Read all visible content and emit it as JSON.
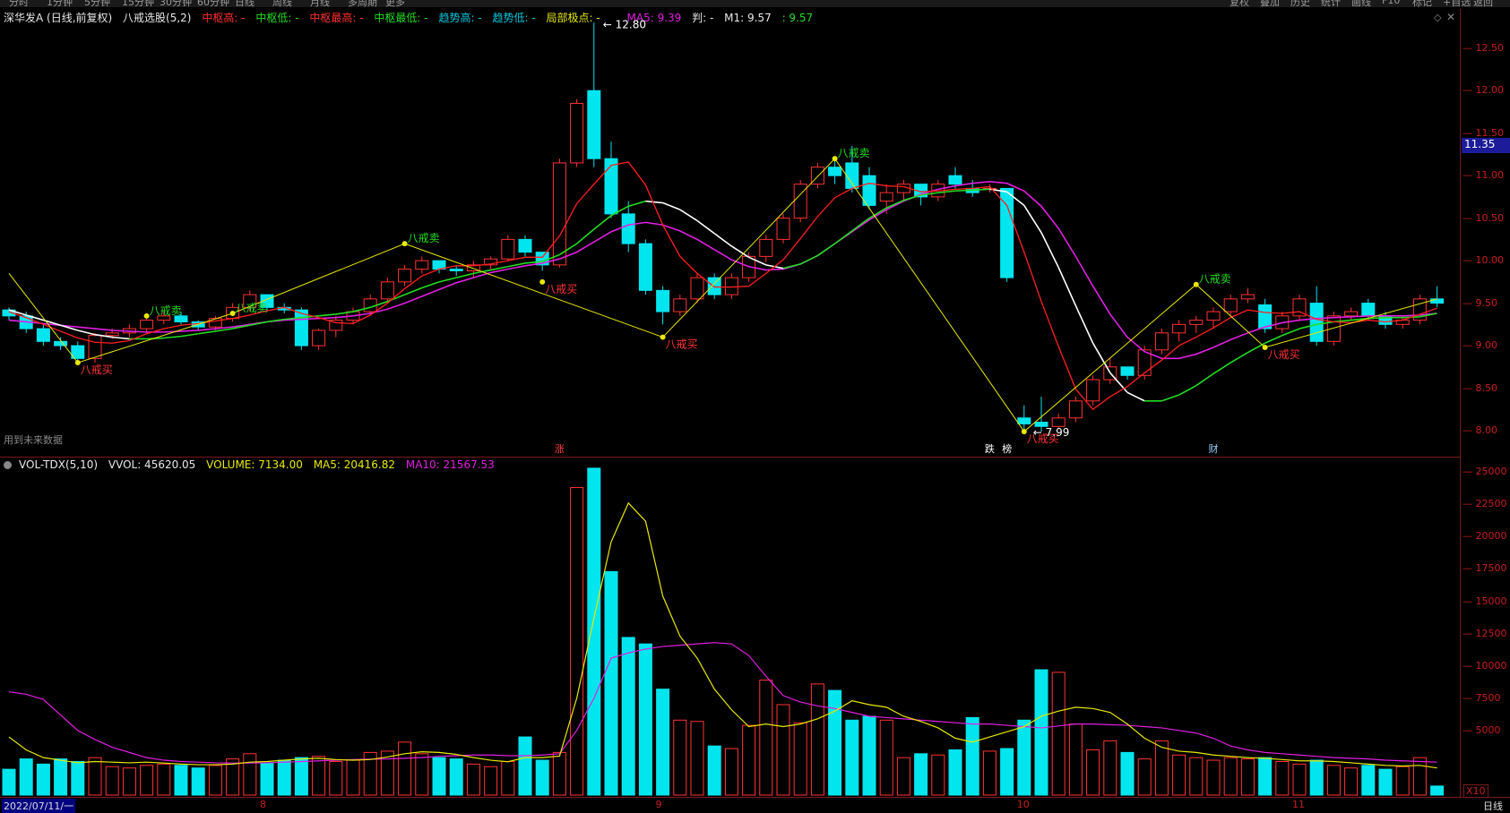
{
  "toolbar_left": [
    "分时",
    "1分钟",
    "5分钟",
    "15分钟",
    "30分钟",
    "60分钟",
    "日线",
    "周线",
    "月线",
    "多周期",
    "更多"
  ],
  "toolbar_right": [
    "复权",
    "叠加",
    "历史",
    "统计",
    "画线",
    "F10",
    "标记",
    "+自选",
    "返回"
  ],
  "header": {
    "stock": "深华发A (日线,前复权)",
    "indicator": "八戒选股(5,2)",
    "zg_high": "中枢高: -",
    "zg_low": "中枢低: -",
    "zg_max": "中枢最高: -",
    "zg_min": "中枢最低: -",
    "trend_high": "趋势高: -",
    "trend_low": "趋势低: -",
    "local_pt": "局部极点: -",
    "ma5": "MA5: 9.39",
    "judge": "判: -",
    "m1": "M1: 9.57",
    "m1b": ": 9.57"
  },
  "vol_header": {
    "name": "VOL-TDX(5,10)",
    "vvol": "VVOL: 45620.05",
    "volume": "VOLUME: 7134.00",
    "ma5": "MA5: 20416.82",
    "ma10": "MA10: 21567.53"
  },
  "future_note": "用到未来数据",
  "current_price_tag": "11.35",
  "x10_label": "X10",
  "period_label": "日线",
  "start_date": "2022/07/11/一",
  "months": [
    {
      "label": "8",
      "i": 15
    },
    {
      "label": "9",
      "i": 38
    },
    {
      "label": "10",
      "i": 59
    },
    {
      "label": "11",
      "i": 75
    }
  ],
  "events": [
    {
      "label": "涨",
      "i": 32
    },
    {
      "label": "跌",
      "i": 57
    },
    {
      "label": "榜",
      "i": 58
    },
    {
      "label": "财",
      "i": 70
    }
  ],
  "signal_labels": {
    "sell": "八戒卖",
    "buy": "八戒买"
  },
  "peak_high_label": "12.80",
  "trough_low_label": "7.99",
  "colors": {
    "up": "#ff3333",
    "down": "#00e5ee",
    "ma5": "#ff2020",
    "m1_white": "#ffffff",
    "m1_green": "#22dd22",
    "magenta": "#e020e0",
    "yellow": "#e8e800",
    "axis": "#c82020"
  },
  "chart_data": [
    {
      "type": "candlestick",
      "ylim": [
        7.8,
        12.75
      ],
      "yticks": [
        8.0,
        8.5,
        9.0,
        9.5,
        10.0,
        10.5,
        11.0,
        11.5,
        12.0,
        12.5
      ],
      "ohlc": [
        [
          9.42,
          9.45,
          9.3,
          9.35
        ],
        [
          9.35,
          9.4,
          9.15,
          9.2
        ],
        [
          9.2,
          9.25,
          9.0,
          9.05
        ],
        [
          9.05,
          9.1,
          8.95,
          9.0
        ],
        [
          9.0,
          9.05,
          8.8,
          8.85
        ],
        [
          8.85,
          9.15,
          8.8,
          9.12
        ],
        [
          9.12,
          9.2,
          9.08,
          9.15
        ],
        [
          9.15,
          9.25,
          9.1,
          9.2
        ],
        [
          9.2,
          9.35,
          9.15,
          9.3
        ],
        [
          9.3,
          9.4,
          9.25,
          9.35
        ],
        [
          9.35,
          9.4,
          9.25,
          9.28
        ],
        [
          9.28,
          9.3,
          9.18,
          9.22
        ],
        [
          9.22,
          9.35,
          9.18,
          9.32
        ],
        [
          9.32,
          9.5,
          9.28,
          9.45
        ],
        [
          9.45,
          9.65,
          9.4,
          9.6
        ],
        [
          9.6,
          9.55,
          9.4,
          9.45
        ],
        [
          9.45,
          9.5,
          9.38,
          9.42
        ],
        [
          9.42,
          9.45,
          8.95,
          9.0
        ],
        [
          9.0,
          9.2,
          8.95,
          9.18
        ],
        [
          9.18,
          9.35,
          9.1,
          9.3
        ],
        [
          9.3,
          9.45,
          9.25,
          9.4
        ],
        [
          9.4,
          9.6,
          9.35,
          9.55
        ],
        [
          9.55,
          9.8,
          9.5,
          9.75
        ],
        [
          9.75,
          9.95,
          9.7,
          9.9
        ],
        [
          9.9,
          10.05,
          9.85,
          10.0
        ],
        [
          10.0,
          9.98,
          9.85,
          9.9
        ],
        [
          9.9,
          9.95,
          9.82,
          9.88
        ],
        [
          9.88,
          10.0,
          9.8,
          9.95
        ],
        [
          9.95,
          10.05,
          9.9,
          10.02
        ],
        [
          10.02,
          10.3,
          10.0,
          10.25
        ],
        [
          10.25,
          10.3,
          10.05,
          10.1
        ],
        [
          10.1,
          10.05,
          9.88,
          9.95
        ],
        [
          9.95,
          11.2,
          9.92,
          11.15
        ],
        [
          11.15,
          11.9,
          11.1,
          11.85
        ],
        [
          12.0,
          12.8,
          11.1,
          11.2
        ],
        [
          11.2,
          11.4,
          10.5,
          10.55
        ],
        [
          10.55,
          10.7,
          10.1,
          10.2
        ],
        [
          10.2,
          10.25,
          9.6,
          9.65
        ],
        [
          9.65,
          9.7,
          9.25,
          9.4
        ],
        [
          9.4,
          9.6,
          9.35,
          9.55
        ],
        [
          9.55,
          9.85,
          9.5,
          9.8
        ],
        [
          9.8,
          9.85,
          9.55,
          9.6
        ],
        [
          9.6,
          9.85,
          9.55,
          9.8
        ],
        [
          9.8,
          10.1,
          9.75,
          10.05
        ],
        [
          10.05,
          10.3,
          9.98,
          10.25
        ],
        [
          10.25,
          10.55,
          10.2,
          10.5
        ],
        [
          10.5,
          10.95,
          10.45,
          10.9
        ],
        [
          10.9,
          11.15,
          10.85,
          11.1
        ],
        [
          11.1,
          11.2,
          10.9,
          11.0
        ],
        [
          11.15,
          11.35,
          10.8,
          10.85
        ],
        [
          11.0,
          11.1,
          10.6,
          10.65
        ],
        [
          10.7,
          10.9,
          10.55,
          10.8
        ],
        [
          10.8,
          10.95,
          10.7,
          10.9
        ],
        [
          10.9,
          10.85,
          10.65,
          10.75
        ],
        [
          10.75,
          10.95,
          10.7,
          10.9
        ],
        [
          11.0,
          11.1,
          10.85,
          10.9
        ],
        [
          10.85,
          10.95,
          10.75,
          10.8
        ],
        [
          10.85,
          10.9,
          10.8,
          10.85
        ],
        [
          10.85,
          10.7,
          9.75,
          9.8
        ],
        [
          8.15,
          8.3,
          7.99,
          8.08
        ],
        [
          8.1,
          8.4,
          7.99,
          8.05
        ],
        [
          8.05,
          8.2,
          8.02,
          8.15
        ],
        [
          8.15,
          8.4,
          8.1,
          8.35
        ],
        [
          8.35,
          8.65,
          8.3,
          8.6
        ],
        [
          8.6,
          8.85,
          8.55,
          8.75
        ],
        [
          8.75,
          8.72,
          8.6,
          8.65
        ],
        [
          8.65,
          9.0,
          8.6,
          8.95
        ],
        [
          8.95,
          9.2,
          8.9,
          9.15
        ],
        [
          9.15,
          9.3,
          9.05,
          9.25
        ],
        [
          9.25,
          9.35,
          9.15,
          9.3
        ],
        [
          9.3,
          9.45,
          9.2,
          9.4
        ],
        [
          9.4,
          9.6,
          9.35,
          9.55
        ],
        [
          9.55,
          9.68,
          9.5,
          9.6
        ],
        [
          9.48,
          9.55,
          9.15,
          9.2
        ],
        [
          9.2,
          9.4,
          9.15,
          9.35
        ],
        [
          9.35,
          9.6,
          9.3,
          9.55
        ],
        [
          9.5,
          9.7,
          9.0,
          9.05
        ],
        [
          9.05,
          9.4,
          9.0,
          9.35
        ],
        [
          9.35,
          9.45,
          9.3,
          9.4
        ],
        [
          9.5,
          9.55,
          9.3,
          9.35
        ],
        [
          9.35,
          9.4,
          9.2,
          9.25
        ],
        [
          9.25,
          9.35,
          9.2,
          9.3
        ],
        [
          9.3,
          9.6,
          9.25,
          9.55
        ],
        [
          9.55,
          9.7,
          9.45,
          9.5
        ]
      ],
      "ma5": [
        9.4,
        9.33,
        9.25,
        9.17,
        9.09,
        9.04,
        9.03,
        9.06,
        9.14,
        9.2,
        9.24,
        9.26,
        9.29,
        9.32,
        9.36,
        9.41,
        9.45,
        9.38,
        9.33,
        9.27,
        9.26,
        9.36,
        9.5,
        9.67,
        9.82,
        9.9,
        9.94,
        9.94,
        9.96,
        10.0,
        10.04,
        10.04,
        10.29,
        10.67,
        10.9,
        11.12,
        11.16,
        10.89,
        10.42,
        10.05,
        9.85,
        9.69,
        9.69,
        9.7,
        9.85,
        10.01,
        10.26,
        10.52,
        10.74,
        10.85,
        10.91,
        10.88,
        10.87,
        10.81,
        10.82,
        10.84,
        10.85,
        10.87,
        10.65,
        10.1,
        9.52,
        8.99,
        8.49,
        8.25,
        8.4,
        8.52,
        8.68,
        8.83,
        9.0,
        9.1,
        9.21,
        9.33,
        9.42,
        9.39,
        9.38,
        9.4,
        9.31,
        9.28,
        9.27,
        9.3,
        9.28,
        9.3,
        9.37,
        9.44
      ],
      "m1": [
        9.42,
        9.36,
        9.3,
        9.24,
        9.18,
        9.13,
        9.1,
        9.08,
        9.08,
        9.09,
        9.11,
        9.14,
        9.17,
        9.2,
        9.24,
        9.28,
        9.31,
        9.33,
        9.35,
        9.37,
        9.4,
        9.45,
        9.52,
        9.6,
        9.68,
        9.75,
        9.8,
        9.85,
        9.89,
        9.93,
        9.97,
        9.99,
        10.07,
        10.2,
        10.37,
        10.53,
        10.64,
        10.7,
        10.68,
        10.6,
        10.47,
        10.32,
        10.17,
        10.04,
        9.95,
        9.91,
        9.96,
        10.06,
        10.2,
        10.35,
        10.5,
        10.62,
        10.71,
        10.77,
        10.8,
        10.82,
        10.83,
        10.84,
        10.81,
        10.65,
        10.33,
        9.92,
        9.47,
        9.03,
        8.68,
        8.45,
        8.35,
        8.35,
        8.42,
        8.53,
        8.67,
        8.8,
        8.92,
        9.03,
        9.12,
        9.2,
        9.25,
        9.28,
        9.3,
        9.32,
        9.33,
        9.33,
        9.34,
        9.38
      ],
      "ma_long": [
        9.3,
        9.28,
        9.26,
        9.24,
        9.22,
        9.2,
        9.18,
        9.17,
        9.16,
        9.16,
        9.17,
        9.18,
        9.2,
        9.22,
        9.25,
        9.28,
        9.3,
        9.31,
        9.32,
        9.33,
        9.35,
        9.38,
        9.43,
        9.5,
        9.58,
        9.66,
        9.74,
        9.8,
        9.86,
        9.9,
        9.94,
        9.97,
        10.02,
        10.1,
        10.22,
        10.34,
        10.42,
        10.45,
        10.42,
        10.35,
        10.25,
        10.13,
        10.01,
        9.93,
        9.89,
        9.9,
        9.96,
        10.06,
        10.2,
        10.34,
        10.48,
        10.6,
        10.7,
        10.78,
        10.84,
        10.88,
        10.91,
        10.93,
        10.91,
        10.82,
        10.64,
        10.38,
        10.05,
        9.7,
        9.37,
        9.1,
        8.93,
        8.85,
        8.85,
        8.9,
        8.98,
        9.07,
        9.15,
        9.22,
        9.27,
        9.3,
        9.32,
        9.33,
        9.34,
        9.35,
        9.35,
        9.35,
        9.36,
        9.38
      ],
      "zigzag": [
        [
          0,
          9.85
        ],
        [
          4,
          8.8
        ],
        [
          13,
          9.38
        ],
        [
          23,
          10.2
        ],
        [
          38,
          9.1
        ],
        [
          48,
          11.2
        ],
        [
          59,
          7.99
        ],
        [
          69,
          9.72
        ],
        [
          73,
          8.98
        ],
        [
          83,
          9.55
        ]
      ],
      "sell_signals": [
        [
          13,
          9.38
        ],
        [
          8,
          9.35
        ],
        [
          23,
          10.2
        ],
        [
          48,
          11.2
        ],
        [
          69,
          9.72
        ]
      ],
      "buy_signals": [
        [
          4,
          8.8
        ],
        [
          31,
          9.75
        ],
        [
          38,
          9.1
        ],
        [
          59,
          7.99
        ],
        [
          73,
          8.98
        ]
      ]
    },
    {
      "type": "bar",
      "ylim": [
        0,
        25500
      ],
      "yticks": [
        5000,
        7500,
        10000,
        12500,
        15000,
        17500,
        20000,
        22500,
        25000
      ],
      "volume": [
        2000,
        2800,
        2400,
        2800,
        2600,
        2900,
        2200,
        2100,
        2300,
        2400,
        2300,
        2100,
        2300,
        2800,
        3200,
        2500,
        2700,
        2900,
        3000,
        2600,
        2700,
        3300,
        3400,
        4100,
        3200,
        2900,
        2800,
        2400,
        2200,
        2600,
        4500,
        2700,
        3300,
        23800,
        25300,
        17300,
        12200,
        11700,
        8200,
        5800,
        5700,
        3800,
        3600,
        5400,
        8900,
        7000,
        5600,
        8600,
        8100,
        5800,
        6100,
        5800,
        2900,
        3200,
        3100,
        3500,
        6000,
        3400,
        3600,
        5800,
        9700,
        9500,
        5500,
        3500,
        4200,
        3300,
        2800,
        4200,
        3100,
        2900,
        2700,
        2900,
        2800,
        2900,
        2600,
        2400,
        2700,
        2300,
        2100,
        2300,
        2000,
        2200,
        2900,
        700
      ],
      "up_flags": [
        0,
        0,
        0,
        0,
        0,
        1,
        1,
        1,
        1,
        1,
        0,
        0,
        1,
        1,
        1,
        0,
        0,
        0,
        1,
        1,
        1,
        1,
        1,
        1,
        1,
        0,
        0,
        1,
        1,
        1,
        0,
        0,
        1,
        1,
        0,
        0,
        0,
        0,
        0,
        1,
        1,
        0,
        1,
        1,
        1,
        1,
        1,
        1,
        0,
        0,
        0,
        1,
        1,
        0,
        1,
        0,
        0,
        1,
        0,
        0,
        0,
        1,
        1,
        1,
        1,
        0,
        1,
        1,
        1,
        1,
        1,
        1,
        1,
        0,
        1,
        1,
        0,
        1,
        1,
        0,
        0,
        1,
        1,
        0
      ],
      "ma5": [
        4500,
        3500,
        2900,
        2700,
        2500,
        2600,
        2550,
        2500,
        2550,
        2480,
        2400,
        2350,
        2350,
        2400,
        2550,
        2600,
        2700,
        2800,
        2850,
        2750,
        2700,
        2750,
        2950,
        3200,
        3350,
        3300,
        3150,
        2900,
        2700,
        2580,
        2900,
        2900,
        3020,
        7500,
        13700,
        19600,
        22600,
        21200,
        15400,
        12300,
        10600,
        8200,
        6600,
        5300,
        5500,
        5300,
        5500,
        5900,
        6500,
        7300,
        7000,
        6800,
        6100,
        5700,
        5200,
        4400,
        4100,
        4500,
        4900,
        5300,
        6100,
        6500,
        6800,
        6700,
        6400,
        5500,
        4400,
        3700,
        3400,
        3300,
        3100,
        3000,
        2900,
        2850,
        2750,
        2650,
        2650,
        2600,
        2500,
        2400,
        2300,
        2250,
        2300,
        2100
      ],
      "ma10": [
        8000,
        7800,
        7400,
        6200,
        5000,
        4300,
        3700,
        3300,
        2900,
        2700,
        2600,
        2550,
        2500,
        2480,
        2480,
        2500,
        2550,
        2600,
        2650,
        2700,
        2750,
        2780,
        2800,
        2850,
        2900,
        3000,
        3050,
        3100,
        3100,
        3050,
        3050,
        3100,
        3200,
        5000,
        7500,
        10600,
        11000,
        11300,
        11500,
        11600,
        11700,
        11800,
        11700,
        10800,
        9200,
        7700,
        7200,
        6900,
        6700,
        6400,
        6100,
        6000,
        5900,
        5800,
        5700,
        5600,
        5500,
        5500,
        5400,
        5300,
        5200,
        5350,
        5500,
        5500,
        5450,
        5400,
        5300,
        5200,
        5000,
        4800,
        4400,
        3800,
        3500,
        3300,
        3200,
        3100,
        3000,
        2900,
        2850,
        2800,
        2700,
        2650,
        2600,
        2550
      ]
    }
  ]
}
